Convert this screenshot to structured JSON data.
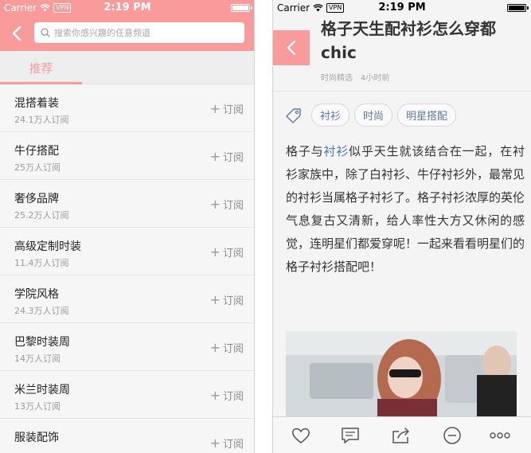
{
  "status_bar": {
    "carrier": "Carrier",
    "vpn": "VPN",
    "time": "2:19 PM"
  },
  "channels": {
    "search_placeholder": "搜索你感兴趣的任意频道",
    "tabs": [
      {
        "label": "推荐"
      }
    ],
    "subscribe_label": "订阅",
    "items": [
      {
        "name": "混搭着装",
        "subscribers": "24.1万人订阅"
      },
      {
        "name": "牛仔搭配",
        "subscribers": "25万人订阅"
      },
      {
        "name": "奢侈品牌",
        "subscribers": "25.2万人订阅"
      },
      {
        "name": "高级定制时装",
        "subscribers": "11.4万人订阅"
      },
      {
        "name": "学院风格",
        "subscribers": "24.3万人订阅"
      },
      {
        "name": "巴黎时装周",
        "subscribers": "14万人订阅"
      },
      {
        "name": "米兰时装周",
        "subscribers": "13万人订阅"
      },
      {
        "name": "服装配饰",
        "subscribers": ""
      }
    ]
  },
  "article": {
    "title": "格子天生配衬衫怎么穿都chic",
    "source": "时尚精选",
    "time_ago": "4小时前",
    "tags": [
      {
        "label": "衬衫"
      },
      {
        "label": "时尚"
      },
      {
        "label": "明星搭配"
      }
    ],
    "body_before": "格子与",
    "body_link": "衬衫",
    "body_after": "似乎天生就该结合在一起，在衬衫家族中，除了白衬衫、牛仔衬衫外，最常见的衬衫当属格子衬衫了。格子衬衫浓厚的英伦气息复古又清新，给人率性大方又休闲的感觉，连明星们都爱穿呢！一起来看看明星们的格子衬衫搭配吧！"
  },
  "toolbar": {
    "icons": [
      "heart-icon",
      "comment-icon",
      "share-icon",
      "dislike-icon",
      "more-icon"
    ]
  },
  "colors": {
    "accent": "#fa9b9b",
    "link": "#4f78b5"
  }
}
